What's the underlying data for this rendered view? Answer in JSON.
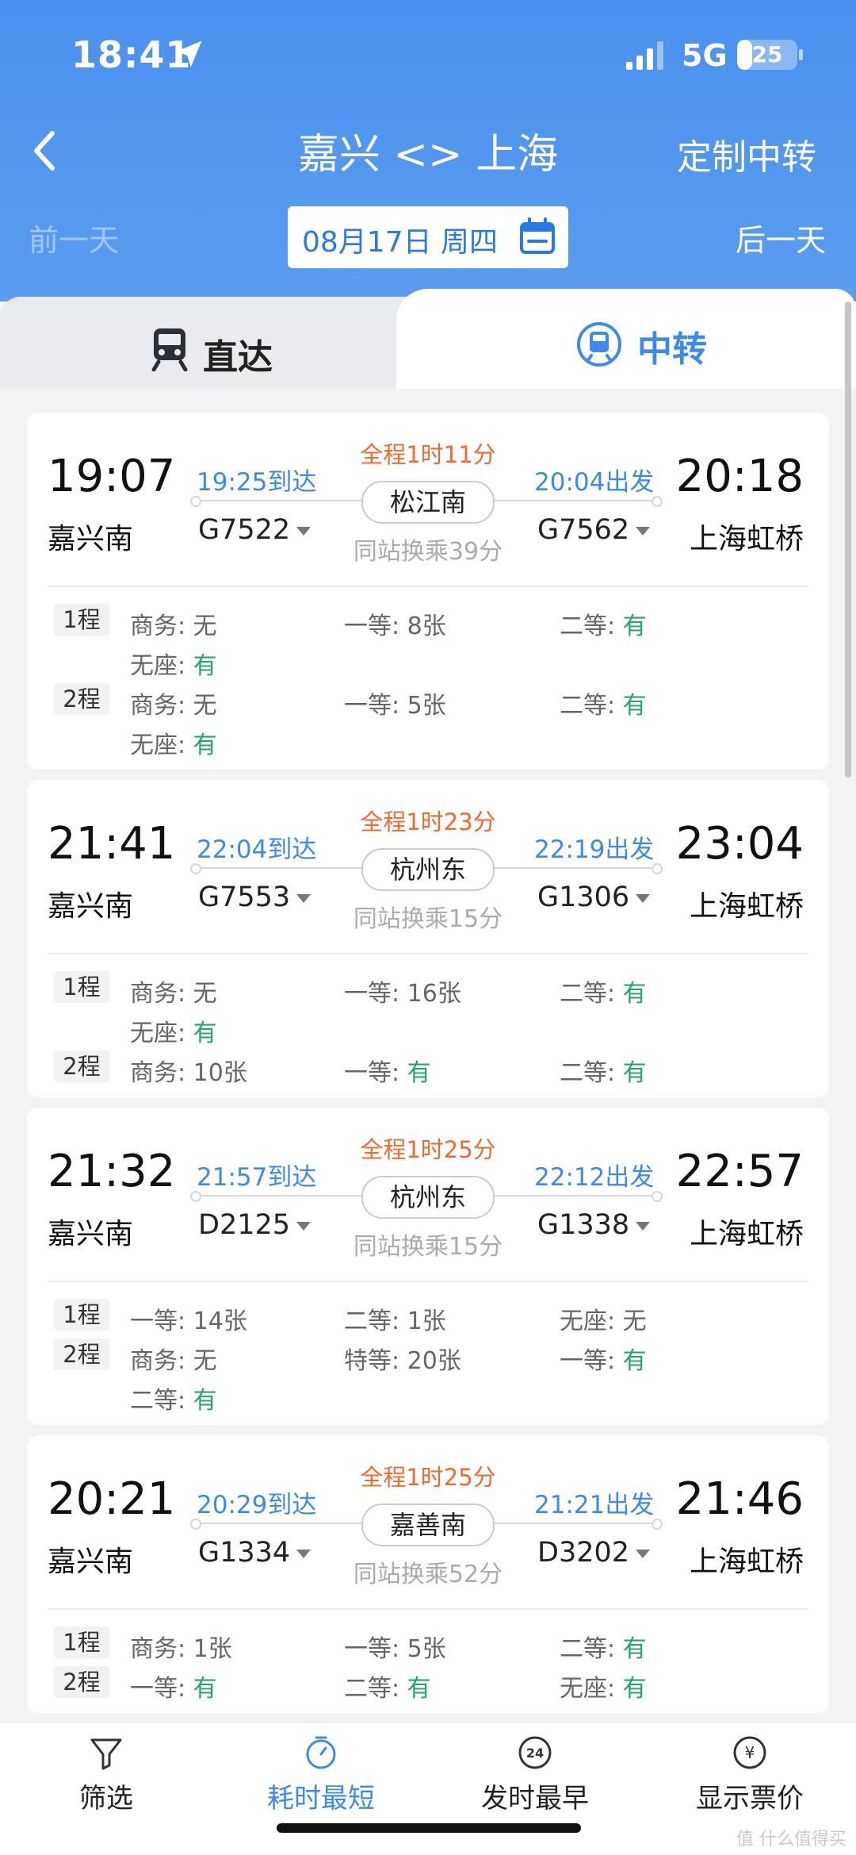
{
  "status": {
    "time": "18:41",
    "network": "5G",
    "battery": "25",
    "battery_level": 0.25
  },
  "nav": {
    "title": "嘉兴 <> 上海",
    "custom": "定制中转"
  },
  "date": {
    "prev": "前一天",
    "current": "08月17日 周四",
    "next": "后一天"
  },
  "tabs": {
    "direct": "直达",
    "transfer": "中转"
  },
  "colors": {
    "primary": "#3d8ae8",
    "orange": "#f06a2c",
    "green": "#25a56a"
  },
  "cards": [
    {
      "dep_time": "19:07",
      "dep_station": "嘉兴南",
      "arr_time": "20:18",
      "arr_station": "上海虹桥",
      "leg1_arrive": "19:25到达",
      "leg2_depart": "20:04出发",
      "duration": "全程1时11分",
      "transfer_station": "松江南",
      "transfer_info": "同站换乘39分",
      "train1": "G7522",
      "train2": "G7562",
      "legs": [
        {
          "label": "1程",
          "seats": [
            {
              "name": "商务: ",
              "value": "无",
              "ok": false
            },
            {
              "name": "一等: ",
              "value": "8张",
              "ok": false
            },
            {
              "name": "二等: ",
              "value": "有",
              "ok": true
            },
            {
              "name": "无座: ",
              "value": "有",
              "ok": true
            }
          ]
        },
        {
          "label": "2程",
          "seats": [
            {
              "name": "商务: ",
              "value": "无",
              "ok": false
            },
            {
              "name": "一等: ",
              "value": "5张",
              "ok": false
            },
            {
              "name": "二等: ",
              "value": "有",
              "ok": true
            },
            {
              "name": "无座: ",
              "value": "有",
              "ok": true
            }
          ]
        }
      ]
    },
    {
      "dep_time": "21:41",
      "dep_station": "嘉兴南",
      "arr_time": "23:04",
      "arr_station": "上海虹桥",
      "leg1_arrive": "22:04到达",
      "leg2_depart": "22:19出发",
      "duration": "全程1时23分",
      "transfer_station": "杭州东",
      "transfer_info": "同站换乘15分",
      "train1": "G7553",
      "train2": "G1306",
      "legs": [
        {
          "label": "1程",
          "seats": [
            {
              "name": "商务: ",
              "value": "无",
              "ok": false
            },
            {
              "name": "一等: ",
              "value": "16张",
              "ok": false
            },
            {
              "name": "二等: ",
              "value": "有",
              "ok": true
            },
            {
              "name": "无座: ",
              "value": "有",
              "ok": true
            }
          ]
        },
        {
          "label": "2程",
          "seats": [
            {
              "name": "商务: ",
              "value": "10张",
              "ok": false
            },
            {
              "name": "一等: ",
              "value": "有",
              "ok": true
            },
            {
              "name": "二等: ",
              "value": "有",
              "ok": true
            }
          ]
        }
      ]
    },
    {
      "dep_time": "21:32",
      "dep_station": "嘉兴南",
      "arr_time": "22:57",
      "arr_station": "上海虹桥",
      "leg1_arrive": "21:57到达",
      "leg2_depart": "22:12出发",
      "duration": "全程1时25分",
      "transfer_station": "杭州东",
      "transfer_info": "同站换乘15分",
      "train1": "D2125",
      "train2": "G1338",
      "legs": [
        {
          "label": "1程",
          "seats": [
            {
              "name": "一等: ",
              "value": "14张",
              "ok": false
            },
            {
              "name": "二等: ",
              "value": "1张",
              "ok": false
            },
            {
              "name": "无座: ",
              "value": "无",
              "ok": false
            }
          ]
        },
        {
          "label": "2程",
          "seats": [
            {
              "name": "商务: ",
              "value": "无",
              "ok": false
            },
            {
              "name": "特等: ",
              "value": "20张",
              "ok": false
            },
            {
              "name": "一等: ",
              "value": "有",
              "ok": true
            },
            {
              "name": "二等: ",
              "value": "有",
              "ok": true
            }
          ]
        }
      ]
    },
    {
      "dep_time": "20:21",
      "dep_station": "嘉兴南",
      "arr_time": "21:46",
      "arr_station": "上海虹桥",
      "leg1_arrive": "20:29到达",
      "leg2_depart": "21:21出发",
      "duration": "全程1时25分",
      "transfer_station": "嘉善南",
      "transfer_info": "同站换乘52分",
      "train1": "G1334",
      "train2": "D3202",
      "legs": [
        {
          "label": "1程",
          "seats": [
            {
              "name": "商务: ",
              "value": "1张",
              "ok": false
            },
            {
              "name": "一等: ",
              "value": "5张",
              "ok": false
            },
            {
              "name": "二等: ",
              "value": "有",
              "ok": true
            }
          ]
        },
        {
          "label": "2程",
          "seats": [
            {
              "name": "一等: ",
              "value": "有",
              "ok": true
            },
            {
              "name": "二等: ",
              "value": "有",
              "ok": true
            },
            {
              "name": "无座: ",
              "value": "有",
              "ok": true
            }
          ]
        }
      ]
    }
  ],
  "bottom": {
    "filter": "筛选",
    "fastest": "耗时最短",
    "earliest": "发时最早",
    "price": "显示票价",
    "clock_num": "24",
    "yen": "¥"
  },
  "watermark": "值 什么值得买"
}
